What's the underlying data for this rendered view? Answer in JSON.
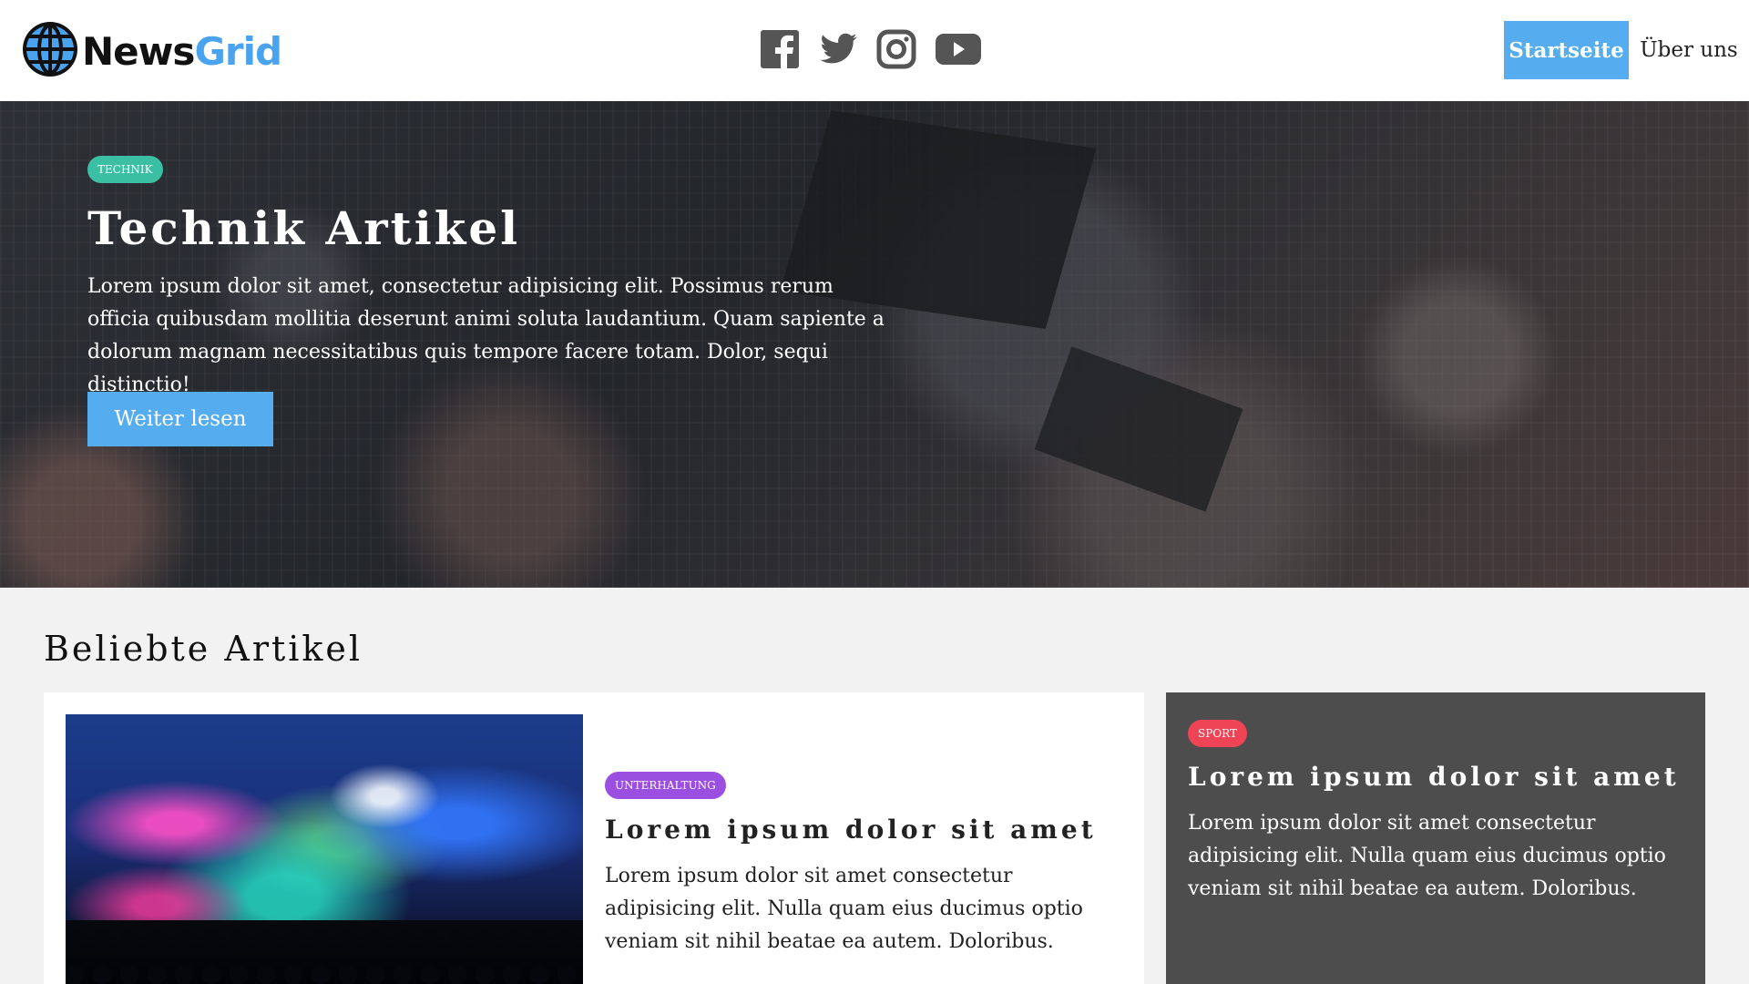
{
  "header": {
    "logo_part1": "News",
    "logo_part2": "Grid",
    "logo_icon": "globe-icon",
    "social": [
      "facebook-icon",
      "twitter-icon",
      "instagram-icon",
      "youtube-icon"
    ],
    "nav": {
      "home": "Startseite",
      "about": "Über uns"
    }
  },
  "hero": {
    "tag": "TECHNIK",
    "title": "Technik Artikel",
    "text": "Lorem ipsum dolor sit amet, consectetur adipisicing elit. Possimus rerum officia quibusdam mollitia deserunt animi soluta laudantium. Quam sapiente a dolorum magnam necessitatibus quis tempore facere totam. Dolor, sequi distinctio!",
    "button": "Weiter lesen"
  },
  "popular": {
    "heading": "Beliebte Artikel",
    "articles": [
      {
        "tag": "UNTERHALTUNG",
        "title": "Lorem ipsum dolor sit amet",
        "text": "Lorem ipsum dolor sit amet consectetur adipisicing elit. Nulla quam eius ducimus optio veniam sit nihil beatae ea autem. Doloribus."
      },
      {
        "tag": "SPORT",
        "title": "Lorem ipsum dolor sit amet",
        "text": "Lorem ipsum dolor sit amet consectetur adipisicing elit. Nulla quam eius ducimus optio veniam sit nihil beatae ea autem. Doloribus."
      }
    ]
  },
  "colors": {
    "accent": "#55acee",
    "technik": "#3bbfa2",
    "unterhaltung": "#9b4fe0",
    "sport": "#ee4455"
  }
}
